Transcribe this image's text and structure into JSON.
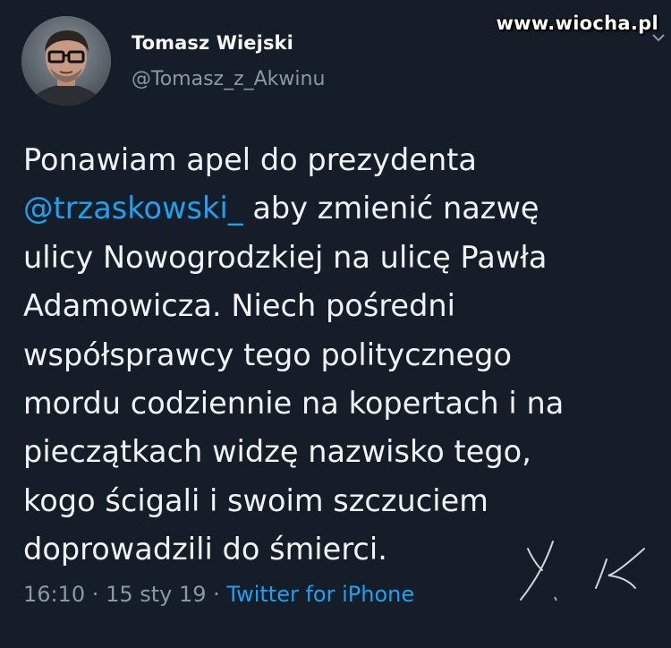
{
  "watermark": "www.wiocha.pl",
  "author": {
    "name": "Tomasz Wiejski",
    "handle": "@Tomasz_z_Akwinu"
  },
  "tweet": {
    "line1": "Ponawiam apel do prezydenta",
    "mention": "@trzaskowski_",
    "line2_rest": " aby zmienić nazwę",
    "line3": "ulicy Nowogrodzkiej na ulicę Pawła",
    "line4": "Adamowicza. Niech pośredni",
    "line5": "współsprawcy tego politycznego",
    "line6": "mordu codziennie na kopertach i na",
    "line7": "pieczątkach widzę nazwisko tego,",
    "line8": "kogo ścigali i swoim szczuciem",
    "line9": "doprowadzili do śmierci."
  },
  "meta": {
    "time": "16:10",
    "sep1": " · ",
    "date": "15 sty 19",
    "sep2": " · ",
    "source": "Twitter for iPhone"
  },
  "colors": {
    "background": "#151e28",
    "mention": "#1da1f2",
    "secondary_text": "#8899a6"
  },
  "icons": {
    "caret": "chevron-down-icon",
    "avatar": "profile-photo"
  }
}
